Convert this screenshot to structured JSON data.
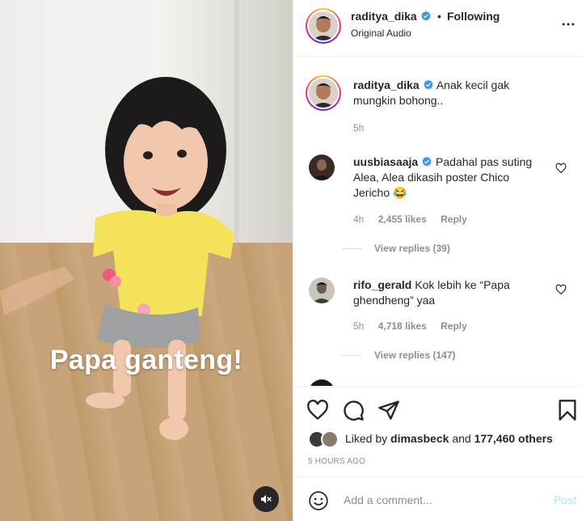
{
  "video": {
    "caption": "Papa ganteng!",
    "mute_icon": "speaker-muted-icon"
  },
  "header": {
    "username": "raditya_dika",
    "separator": "•",
    "follow_status": "Following",
    "audio_label": "Original Audio",
    "more_icon": "more-horizontal-icon"
  },
  "caption_post": {
    "username": "raditya_dika",
    "text": "Anak kecil gak mungkin bohong..",
    "time": "5h"
  },
  "comments": [
    {
      "username": "uusbiasaaja",
      "verified": true,
      "text": "Padahal pas suting Alea, Alea dikasih poster Chico Jericho 😂",
      "time": "4h",
      "likes": "2,455 likes",
      "reply_label": "Reply",
      "view_replies": "View replies (39)"
    },
    {
      "username": "rifo_gerald",
      "verified": false,
      "text": "Kok lebih ke “Papa ghendheng” yaa",
      "time": "5h",
      "likes": "4,718 likes",
      "reply_label": "Reply",
      "view_replies": "View replies (147)"
    }
  ],
  "actions": {
    "icons": [
      "heart-icon",
      "comment-icon",
      "share-icon",
      "bookmark-icon"
    ],
    "liked_by_prefix": "Liked by",
    "liked_by_user": "dimasbeck",
    "liked_by_and": "and",
    "liked_by_others": "177,460 others",
    "time_ago": "5 HOURS AGO"
  },
  "add_comment": {
    "placeholder": "Add a comment...",
    "post_label": "Post"
  },
  "colors": {
    "verified": "#3897f0",
    "link_disabled": "#b2dffc",
    "muted_text": "#8e8e8e",
    "primary_text": "#262626"
  }
}
